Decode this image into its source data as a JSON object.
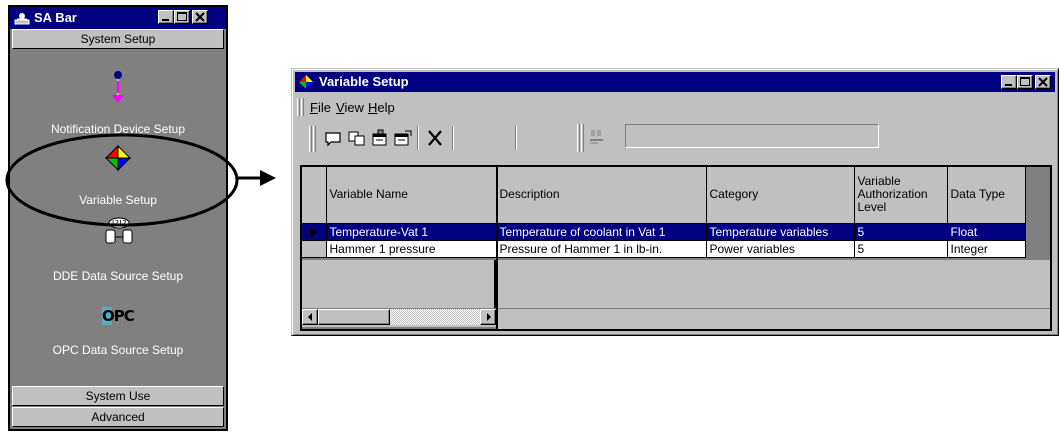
{
  "sa_bar": {
    "title": "SA Bar",
    "sections": {
      "top": "System Setup",
      "system_use": "System Use",
      "advanced": "Advanced"
    },
    "items": [
      {
        "label": "Notification Device Setup",
        "icon": "notification-device-icon"
      },
      {
        "label": "Variable Setup",
        "icon": "variable-setup-icon"
      },
      {
        "label": "DDE Data Source Setup",
        "icon": "dde-data-source-icon"
      },
      {
        "label": "OPC Data Source Setup",
        "icon": "opc-data-source-icon",
        "icon_text": "OPC"
      }
    ]
  },
  "variable_window": {
    "title": "Variable Setup",
    "menu": [
      {
        "label": "File",
        "hotkey": "F"
      },
      {
        "label": "View",
        "hotkey": "V"
      },
      {
        "label": "Help",
        "hotkey": "H"
      }
    ],
    "toolbar": [
      "new-icon",
      "copy-icon",
      "properties-icon",
      "edit-properties-icon",
      "delete-icon",
      "find-icon"
    ],
    "find_value": "",
    "table": {
      "columns": [
        "Variable Name",
        "Description",
        "Category",
        "Variable Authorization Level",
        "Data Type"
      ],
      "rows": [
        [
          "Temperature-Vat 1",
          "Temperature of coolant in Vat 1",
          "Temperature variables",
          "5",
          "Float"
        ],
        [
          "Hammer 1 pressure",
          "Pressure of Hammer 1 in lb-in.",
          "Power variables",
          "5",
          "Integer"
        ]
      ],
      "selected_row": 0
    }
  },
  "colors": {
    "titlebar": "#000080",
    "face": "#c0c0c0",
    "selection": "#000080",
    "sabar_bg": "#808080"
  }
}
